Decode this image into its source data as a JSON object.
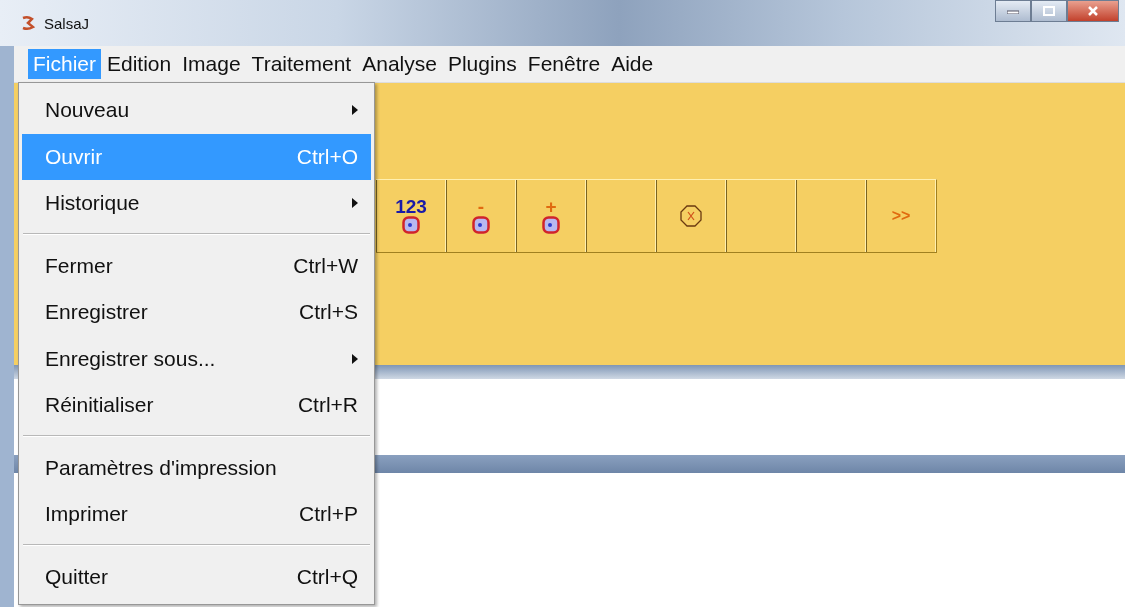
{
  "window": {
    "title": "SalsaJ"
  },
  "menubar": [
    {
      "label": "Fichier",
      "selected": true
    },
    {
      "label": "Edition",
      "selected": false
    },
    {
      "label": "Image",
      "selected": false
    },
    {
      "label": "Traitement",
      "selected": false
    },
    {
      "label": "Analyse",
      "selected": false
    },
    {
      "label": "Plugins",
      "selected": false
    },
    {
      "label": "Fenêtre",
      "selected": false
    },
    {
      "label": "Aide",
      "selected": false
    }
  ],
  "menu": [
    {
      "kind": "item",
      "label": "Nouveau",
      "submenu": true,
      "selected": false
    },
    {
      "kind": "item",
      "label": "Ouvrir",
      "shortcut": "Ctrl+O",
      "selected": true
    },
    {
      "kind": "item",
      "label": "Historique",
      "submenu": true,
      "selected": false
    },
    {
      "kind": "separator"
    },
    {
      "kind": "item",
      "label": "Fermer",
      "shortcut": "Ctrl+W",
      "selected": false
    },
    {
      "kind": "item",
      "label": "Enregistrer",
      "shortcut": "Ctrl+S",
      "selected": false
    },
    {
      "kind": "item",
      "label": "Enregistrer sous...",
      "submenu": true,
      "selected": false
    },
    {
      "kind": "item",
      "label": "Réinitialiser",
      "shortcut": "Ctrl+R",
      "selected": false
    },
    {
      "kind": "separator"
    },
    {
      "kind": "item",
      "label": "Paramètres d'impression",
      "selected": false
    },
    {
      "kind": "item",
      "label": "Imprimer",
      "shortcut": "Ctrl+P",
      "selected": false
    },
    {
      "kind": "separator"
    },
    {
      "kind": "item",
      "label": "Quitter",
      "shortcut": "Ctrl+Q",
      "selected": false
    }
  ],
  "toolbar": [
    {
      "kind": "point",
      "label": "123",
      "color": "#1a1aa8"
    },
    {
      "kind": "point",
      "label": "-",
      "color": "#e06a10"
    },
    {
      "kind": "point",
      "label": "+",
      "color": "#e06a10"
    },
    {
      "kind": "empty"
    },
    {
      "kind": "close"
    },
    {
      "kind": "empty"
    },
    {
      "kind": "empty"
    },
    {
      "kind": "text",
      "label": ">>",
      "color": "#e06a10"
    }
  ]
}
